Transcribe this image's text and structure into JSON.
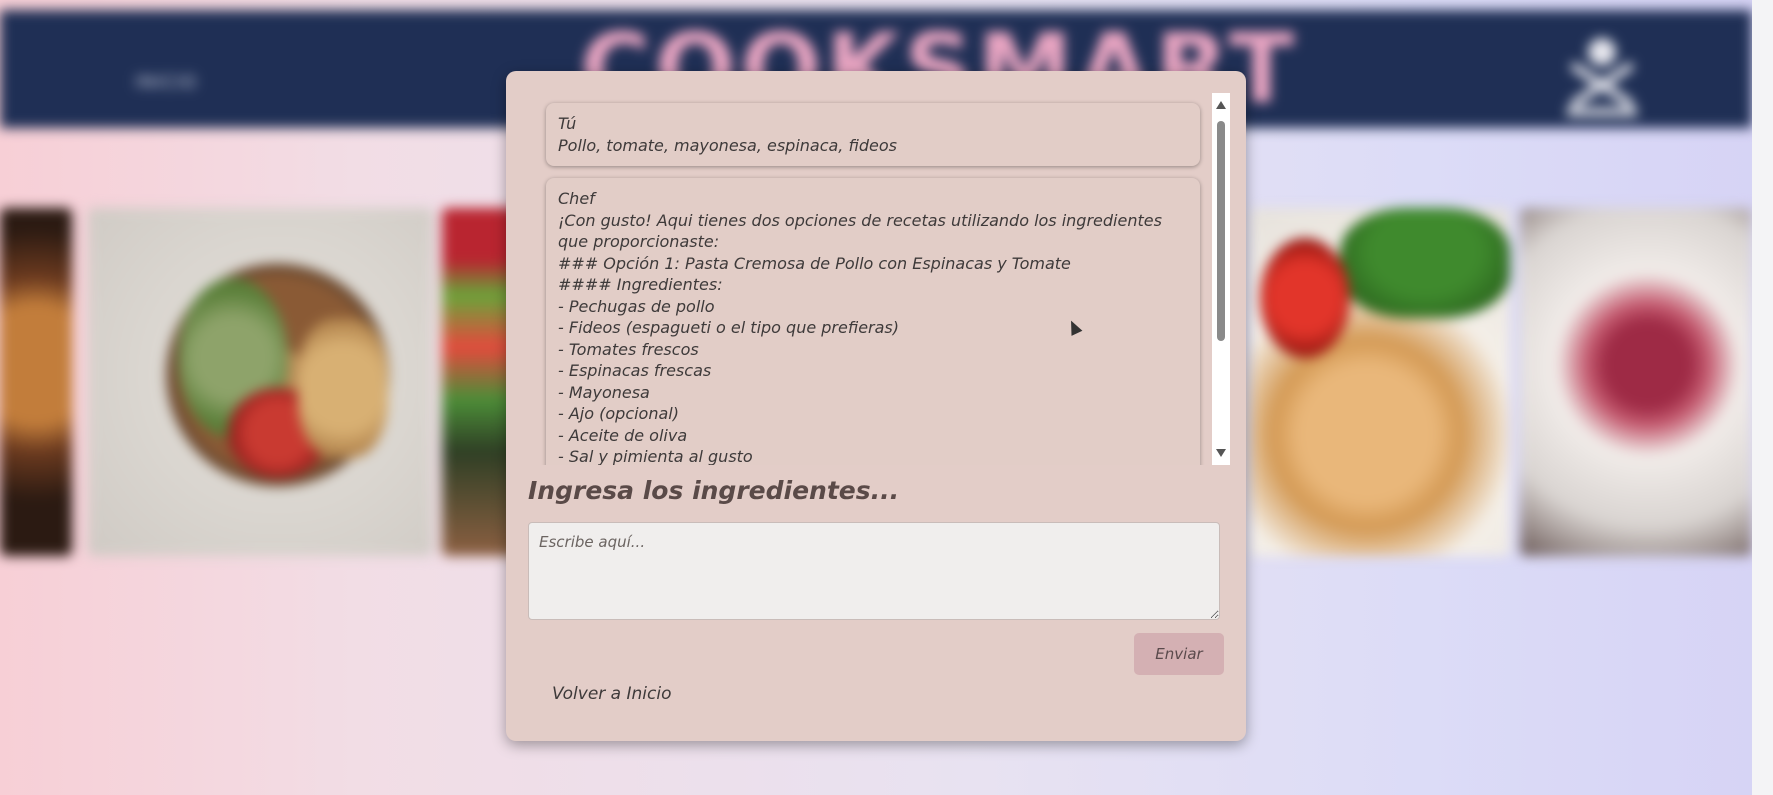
{
  "header": {
    "nav_link": "INICIO",
    "brand": "COOKSMART"
  },
  "chat": {
    "messages": [
      {
        "sender": "Tú",
        "text": "Pollo, tomate, mayonesa, espinaca, fideos"
      },
      {
        "sender": "Chef",
        "lines": [
          "¡Con gusto! Aqui tienes dos opciones de recetas utilizando los ingredientes que proporcionaste:",
          "### Opción 1: Pasta Cremosa de Pollo con Espinacas y Tomate",
          "#### Ingredientes:",
          "- Pechugas de pollo",
          "- Fideos (espagueti o el tipo que prefieras)",
          "- Tomates frescos",
          "- Espinacas frescas",
          "- Mayonesa",
          "- Ajo (opcional)",
          "- Aceite de oliva",
          "- Sal y pimienta al gusto"
        ]
      }
    ]
  },
  "form": {
    "label": "Ingresa los ingredientes...",
    "placeholder": "Escribe aquí...",
    "value": "",
    "send_label": "Enviar",
    "back_label": "Volver a Inicio"
  },
  "colors": {
    "header_bg": "#1f2f55",
    "brand_color": "#e9a5c2",
    "modal_bg": "#e3cdc8",
    "send_button_bg": "#d4b0b3"
  }
}
